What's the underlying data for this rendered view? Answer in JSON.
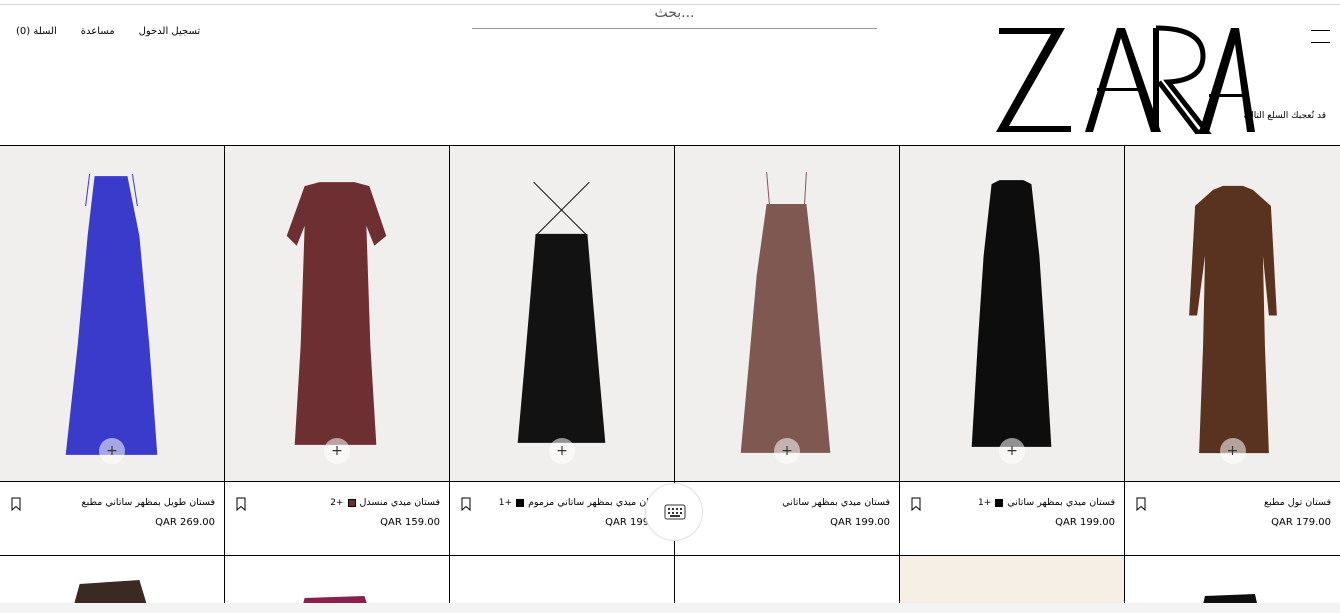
{
  "header": {
    "cart_label": "السلة (0)",
    "help_label": "مساعدة",
    "login_label": "تسجيل الدخول",
    "search_placeholder": "بحث...",
    "logo_text": "ZARA",
    "promo_text": "قد تُعجبك السلع التالية"
  },
  "products": [
    {
      "name": "فستان طويل بمظهر ساتاني مطبع",
      "price": "QAR 269.00",
      "swatch_color": "",
      "extra": "",
      "dress_color": "#3a3acb"
    },
    {
      "name": "فستان ميدي منسدل",
      "price": "QAR 159.00",
      "swatch_color": "#6b2d34",
      "extra": "+2",
      "dress_color": "#6e2f33"
    },
    {
      "name": "فستان ميدي بمظهر ساتاني مزموم",
      "price": "QAR 199.00",
      "swatch_color": "#000000",
      "extra": "+1",
      "dress_color": "#121212"
    },
    {
      "name": "فستان ميدي بمظهر ساتاني",
      "price": "QAR 199.00",
      "swatch_color": "",
      "extra": "",
      "dress_color": "#805852"
    },
    {
      "name": "فستان ميدي بمظهر ساتاني",
      "price": "QAR 199.00",
      "swatch_color": "#000000",
      "extra": "+1",
      "dress_color": "#0d0d0d"
    },
    {
      "name": "فستان تول مطبع",
      "price": "QAR 179.00",
      "swatch_color": "",
      "extra": "",
      "dress_color": "#5a3320"
    }
  ],
  "colors": {
    "image_bg": "#f1efed",
    "border": "#000000"
  }
}
